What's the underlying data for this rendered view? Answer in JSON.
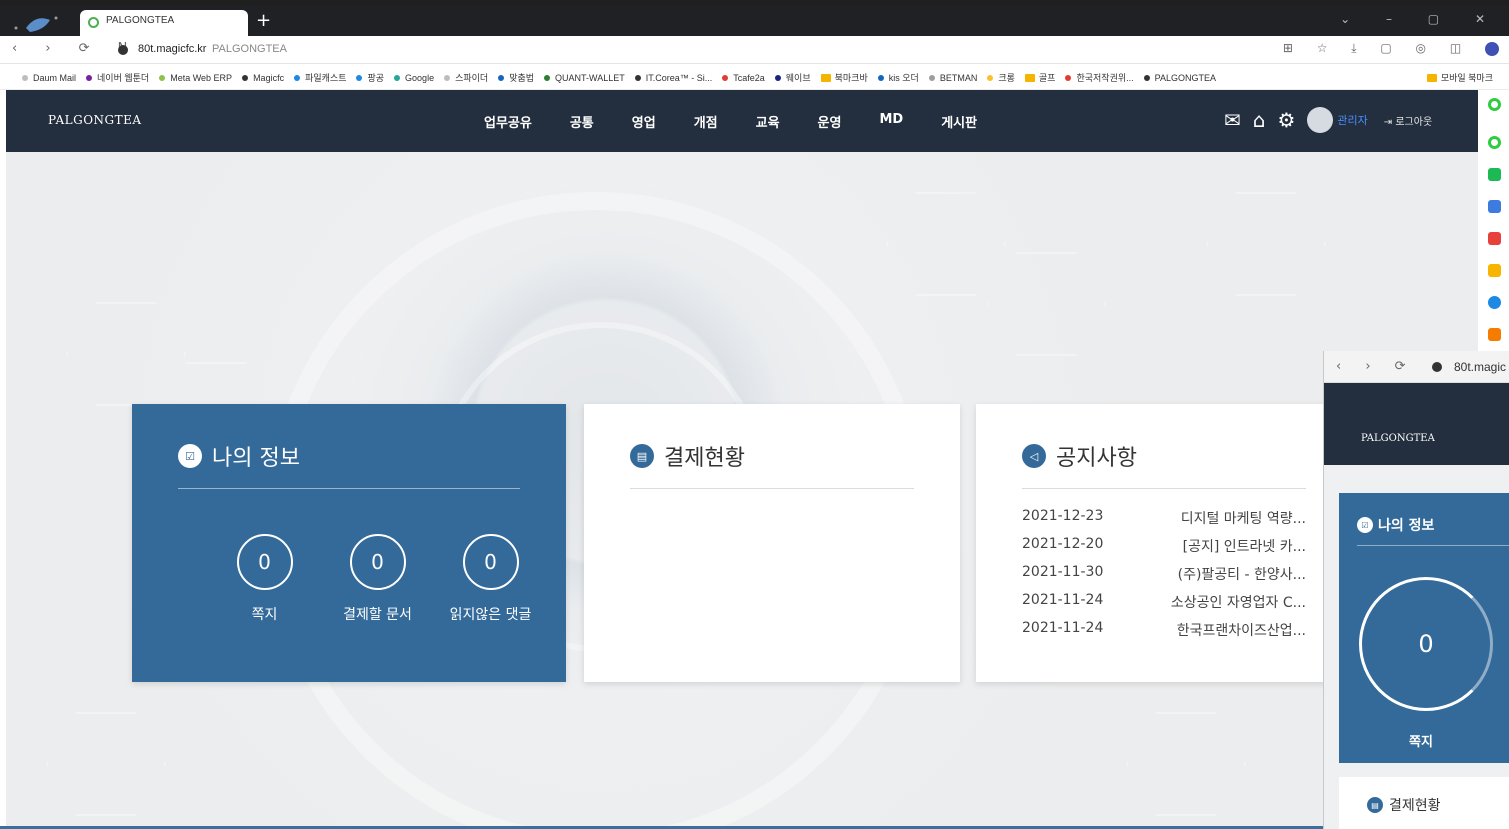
{
  "browser": {
    "tab_title": "PALGONGTEA",
    "new_tab": "+",
    "window_controls": "⌄ – ▢ ✕",
    "nav_icons": "‹ › ⟳ N",
    "url_host": "80t.magicfc.kr",
    "url_title": "PALGONGTEA",
    "ext_icons": "⊞ ☆ ⤓ ▢ ◎ ◫"
  },
  "bookmarks": {
    "items": [
      {
        "label": "Daum Mail",
        "color": "#bdbdbd"
      },
      {
        "label": "네이버 웹툰더",
        "color": "#7b1fa2"
      },
      {
        "label": "Meta Web ERP",
        "color": "#8bc34a"
      },
      {
        "label": "Magicfc",
        "color": "#333333"
      },
      {
        "label": "파일캐스트",
        "color": "#1e88e5"
      },
      {
        "label": "팡공",
        "color": "#1e88e5"
      },
      {
        "label": "Google",
        "color": "#26a69a"
      },
      {
        "label": "스파이더",
        "color": "#bdbdbd"
      },
      {
        "label": "맞춤법",
        "color": "#1565c0"
      },
      {
        "label": "QUANT-WALLET",
        "color": "#2e7d32"
      },
      {
        "label": "IT.Corea™ - Si...",
        "color": "#333333"
      },
      {
        "label": "Tcafe2a",
        "color": "#e53935"
      },
      {
        "label": "웨이브",
        "color": "#1a237e"
      },
      {
        "label": "북마크바",
        "color": "#f4b400"
      },
      {
        "label": "kis 오더",
        "color": "#1565c0"
      },
      {
        "label": "BETMAN",
        "color": "#9e9e9e"
      },
      {
        "label": "크롱",
        "color": "#fbc02d"
      },
      {
        "label": "골프",
        "color": "#f4b400"
      },
      {
        "label": "한국저작권위...",
        "color": "#e53935"
      },
      {
        "label": "PALGONGTEA",
        "color": "#333333"
      }
    ],
    "right_label": "모바일 북마크"
  },
  "header": {
    "brand": "PALGONGTEA",
    "nav": [
      "업무공유",
      "공통",
      "영업",
      "개점",
      "교육",
      "운영",
      "MD",
      "게시판"
    ],
    "mail_icon": "✉",
    "dash_icon": "⌂",
    "settings_icon": "⚙",
    "admin_label": "관리자",
    "logout_label": "⇥ 로그아웃"
  },
  "cards": {
    "info": {
      "title": "나의 정보",
      "icon": "☑",
      "stats": [
        {
          "value": "0",
          "label": "쪽지"
        },
        {
          "value": "0",
          "label": "결제할 문서"
        },
        {
          "value": "0",
          "label": "읽지않은 댓글"
        }
      ]
    },
    "approval": {
      "title": "결제현황",
      "icon": "▤"
    },
    "notice": {
      "title": "공지사항",
      "icon": "◁",
      "rows": [
        {
          "date": "2021-12-23",
          "title": "디지털 마케팅 역량..."
        },
        {
          "date": "2021-12-20",
          "title": "[공지] 인트라넷 카..."
        },
        {
          "date": "2021-11-30",
          "title": "(주)팔공티 - 한양사..."
        },
        {
          "date": "2021-11-24",
          "title": "소상공인 자영업자 C..."
        },
        {
          "date": "2021-11-24",
          "title": "한국프랜차이즈산업..."
        }
      ]
    }
  },
  "mini_window": {
    "nav": "‹ › ⟳",
    "host": "80t.magic",
    "brand": "PALGONGTEA",
    "info_title": "나의 정보",
    "info_value": "0",
    "info_label": "쪽지",
    "approval_title": "결제현황"
  },
  "colors": {
    "header_bg": "#232f3e",
    "card_blue": "#346a9a",
    "admin_blue": "#4a8cff"
  }
}
